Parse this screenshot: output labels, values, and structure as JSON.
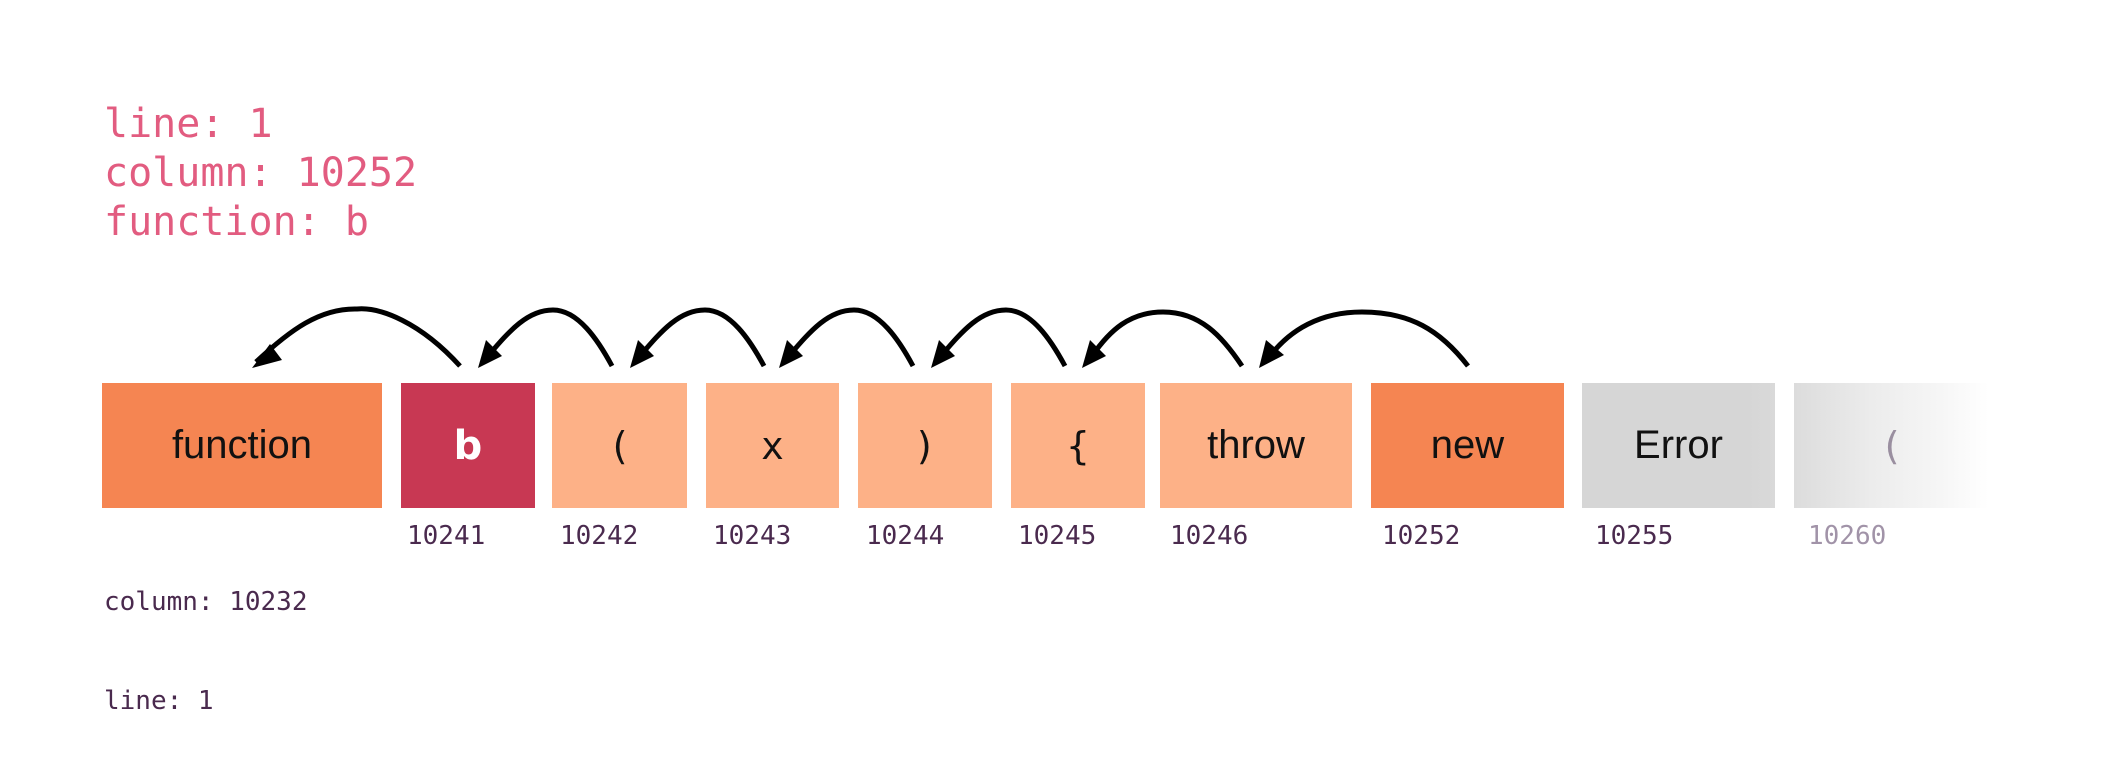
{
  "header": {
    "line": "line: 1",
    "column": "column: 10252",
    "function": "function: b"
  },
  "colors": {
    "keyword": "#f58552",
    "identifier": "#c83853",
    "punctuation": "#fdb187",
    "neutral": "#d6d6d6",
    "header_text": "#e25c80",
    "label_text": "#4a2a4e"
  },
  "tokens": [
    {
      "text": "function",
      "column": "10232",
      "kind": "keyword"
    },
    {
      "text": "b",
      "column": "10241",
      "kind": "identifier"
    },
    {
      "text": "(",
      "column": "10242",
      "kind": "punctuation"
    },
    {
      "text": "x",
      "column": "10243",
      "kind": "punctuation"
    },
    {
      "text": ")",
      "column": "10244",
      "kind": "punctuation"
    },
    {
      "text": "{",
      "column": "10245",
      "kind": "punctuation"
    },
    {
      "text": "throw",
      "column": "10246",
      "kind": "punctuation"
    },
    {
      "text": "new",
      "column": "10252",
      "kind": "keyword"
    },
    {
      "text": "Error",
      "column": "10255",
      "kind": "neutral"
    },
    {
      "text": "(",
      "column": "10260",
      "kind": "faded"
    }
  ],
  "first_label": {
    "column": "column: 10232",
    "line": "line: 1"
  },
  "arrows": [
    {
      "from": "b",
      "to": "function"
    },
    {
      "from": "(",
      "to": "b"
    },
    {
      "from": "x",
      "to": "("
    },
    {
      "from": ")",
      "to": "x"
    },
    {
      "from": "{",
      "to": ")"
    },
    {
      "from": "throw",
      "to": "{"
    },
    {
      "from": "new",
      "to": "throw"
    }
  ]
}
